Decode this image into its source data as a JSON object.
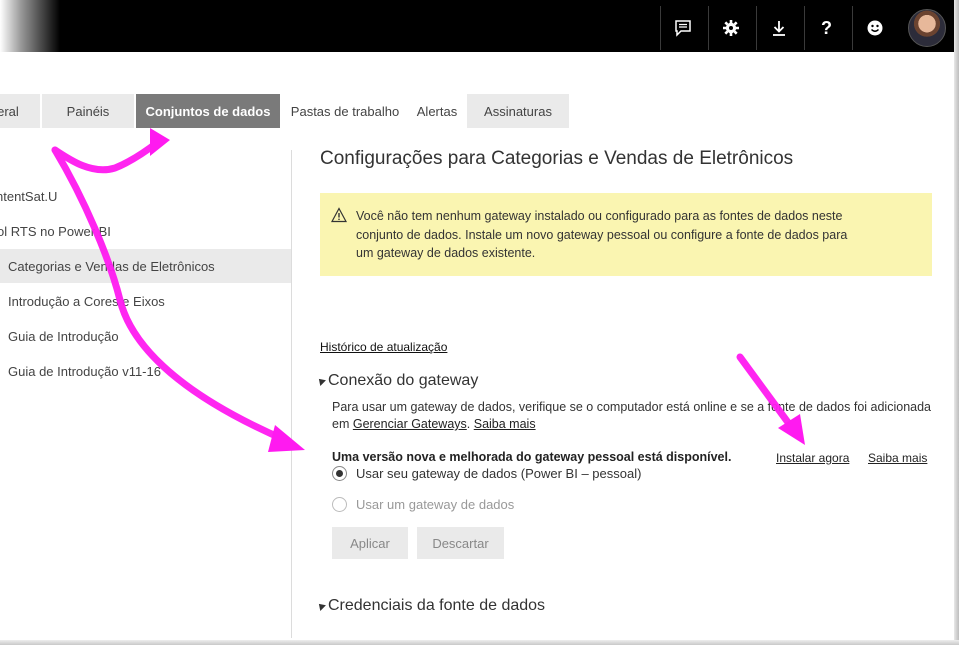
{
  "topbar": {
    "icons": [
      "feedback-icon",
      "gear-icon",
      "download-icon",
      "help-icon",
      "smiley-icon"
    ],
    "help_label": "?"
  },
  "tabs": [
    {
      "label": "Geral"
    },
    {
      "label": "Painéis"
    },
    {
      "label": "Conjuntos de dados",
      "active": true
    },
    {
      "label": "Pastas de trabalho"
    },
    {
      "label": "Alertas"
    },
    {
      "label": "Assinaturas"
    }
  ],
  "sidebar": {
    "items": [
      {
        "label": "ntentSat.U"
      },
      {
        "label": "ol RTS no Power BI"
      },
      {
        "label": "Categorias e Vendas de Eletrônicos",
        "selected": true
      },
      {
        "label": "Introdução a Cores e Eixos"
      },
      {
        "label": "Guia de Introdução"
      },
      {
        "label": "Guia de Introdução v11-16"
      }
    ]
  },
  "main": {
    "title": "Configurações para Categorias e Vendas de Eletrônicos",
    "warning": {
      "icon": "warning-icon",
      "line1": "Você não tem nenhum gateway instalado ou configurado para as fontes de dados neste",
      "line2": "conjunto de dados. Instale um novo gateway pessoal ou configure a fonte de dados para",
      "line3": "um gateway de dados existente."
    },
    "history_link": "Histórico de atualização",
    "gateway": {
      "header": "Conexão do gateway",
      "desc_line1": "Para usar um gateway de dados, verifique se o computador está online e se a fonte de dados foi adicionada",
      "desc_prefix": "em ",
      "manage_link": "Gerenciar Gateways",
      "separator": ". ",
      "learn_more": "Saiba mais",
      "new_version": "Uma versão nova e melhorada do gateway pessoal está disponível.",
      "install_now": "Instalar agora",
      "learn_more_2": "Saiba mais",
      "radio_personal": "Usar seu gateway de dados (Power BI – pessoal)",
      "radio_enterprise": "Usar um gateway de dados",
      "apply_button": "Aplicar",
      "discard_button": "Descartar"
    },
    "credentials_header": "Credenciais da fonte de dados"
  },
  "colors": {
    "topbar": "#000000",
    "active_tab": "#7a7a7a",
    "warning_bg": "#faf5b1",
    "annotation_arrow": "#ff00ff"
  }
}
